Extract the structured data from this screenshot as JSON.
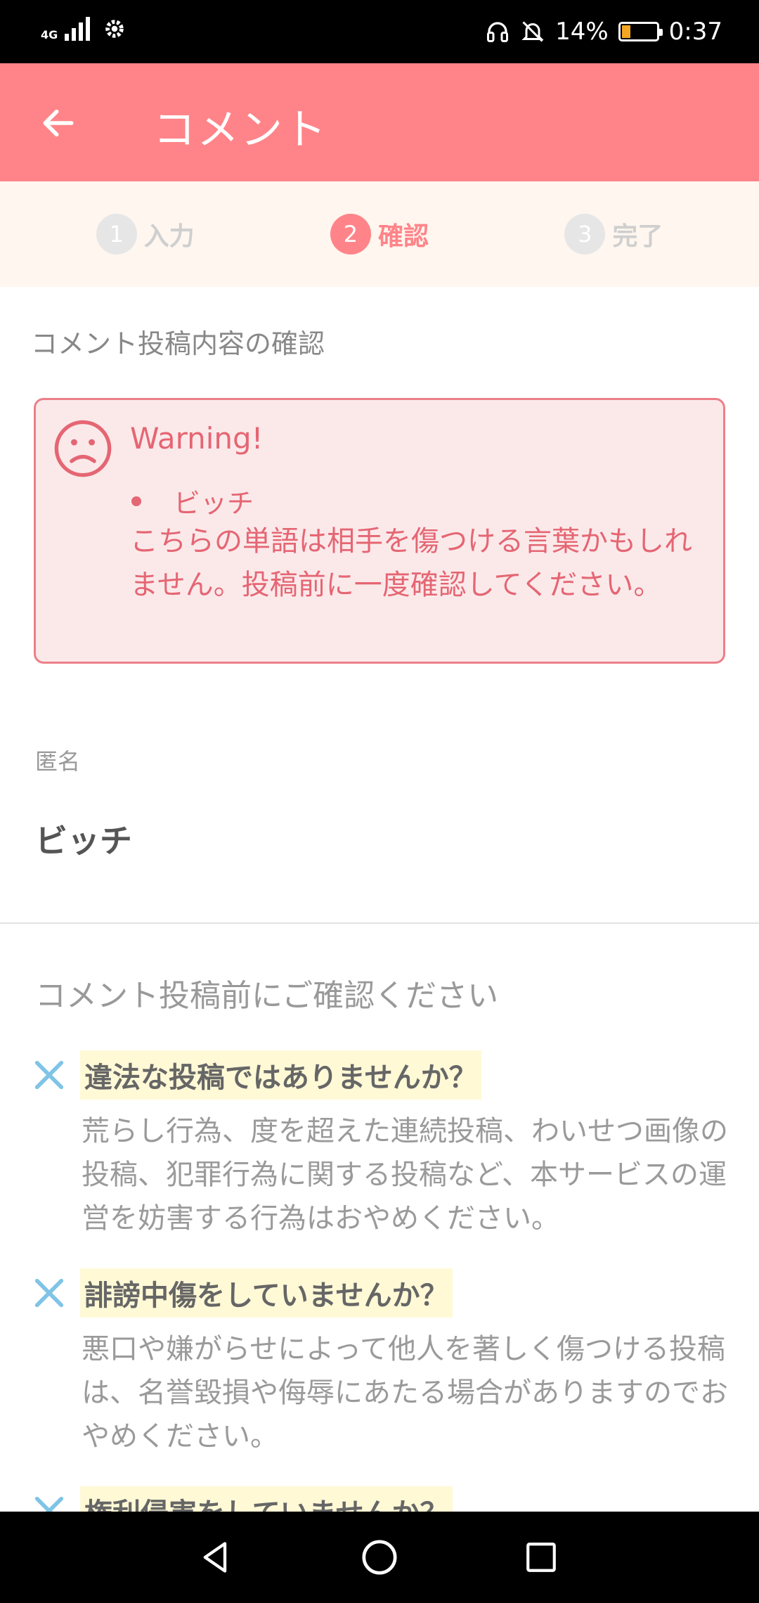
{
  "status_bar": {
    "network": "4G",
    "battery": "14%",
    "time": "0:37",
    "icons": [
      "signal-icon",
      "settings-icon",
      "headphones-icon",
      "mute-icon",
      "battery-icon"
    ]
  },
  "app_bar": {
    "title": "コメント",
    "back_icon": "arrow-left-icon"
  },
  "steps": [
    {
      "num": "1",
      "label": "入力",
      "active": false
    },
    {
      "num": "2",
      "label": "確認",
      "active": true
    },
    {
      "num": "3",
      "label": "完了",
      "active": false
    }
  ],
  "section_title": "コメント投稿内容の確認",
  "warning": {
    "title": "Warning!",
    "word": "ビッチ",
    "message": "こちらの単語は相手を傷つける言葉かもしれません。投稿前に一度確認してください。",
    "icon": "sad-face-icon"
  },
  "comment": {
    "author_label": "匿名",
    "body": "ビッチ"
  },
  "checklist": {
    "title": "コメント投稿前にご確認ください",
    "items": [
      {
        "question": "違法な投稿ではありませんか？",
        "description": "荒らし行為、度を超えた連続投稿、わいせつ画像の投稿、犯罪行為に関する投稿など、本サービスの運営を妨害する行為はおやめください。"
      },
      {
        "question": "誹謗中傷をしていませんか？",
        "description": "悪口や嫌がらせによって他人を著しく傷つける投稿は、名誉毀損や侮辱にあたる場合がありますのでおやめください。"
      },
      {
        "question": "権利侵害をしていませんか？",
        "description": ""
      }
    ]
  },
  "colors": {
    "accent": "#ff8489",
    "warning_text": "#e56673",
    "warning_bg": "#fbe9ea",
    "highlight": "#fff9d6",
    "x_icon": "#7fc4e6"
  }
}
